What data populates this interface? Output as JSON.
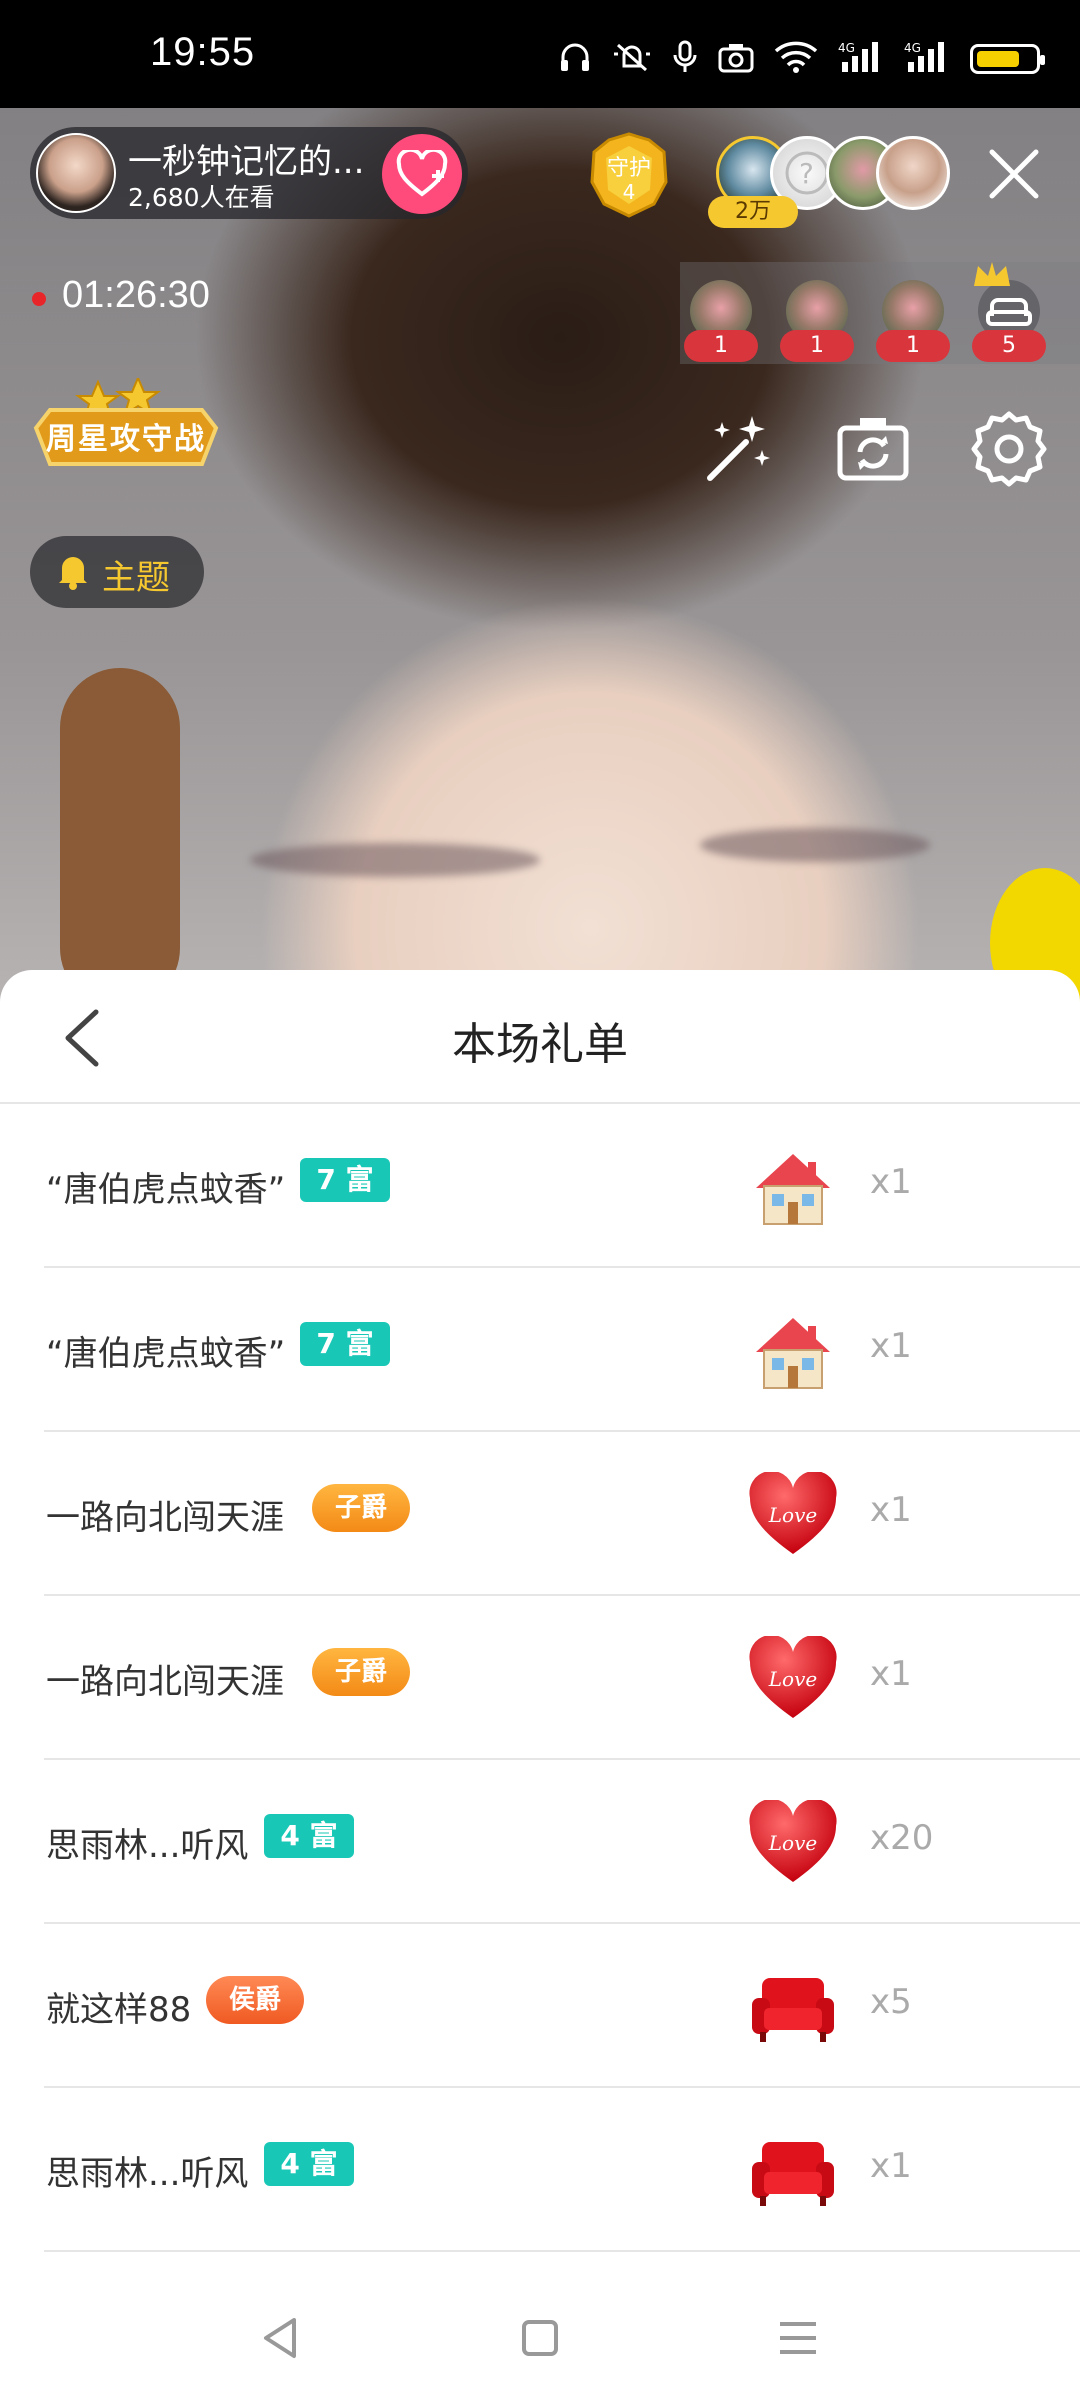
{
  "status_bar": {
    "time": "19:55"
  },
  "live": {
    "anchor": {
      "name": "一秒钟记忆的...",
      "viewers": "2,680人在看"
    },
    "guard": {
      "label": "守护",
      "count": "4"
    },
    "top_badge": "2万",
    "timer": "01:26:30",
    "ranks": [
      "1",
      "1",
      "1",
      "5"
    ],
    "event_label": "周星攻守战",
    "theme_label": "主题"
  },
  "sheet": {
    "title": "本场礼单",
    "rows": [
      {
        "name": "“唐伯虎点蚊香”",
        "badge": "7 富",
        "badge_type": "level",
        "gift": "house",
        "count": "x1"
      },
      {
        "name": "“唐伯虎点蚊香”",
        "badge": "7 富",
        "badge_type": "level",
        "gift": "house",
        "count": "x1"
      },
      {
        "name": "一路向北闯天涯",
        "badge": "子爵",
        "badge_type": "zi",
        "gift": "love-heart",
        "count": "x1"
      },
      {
        "name": "一路向北闯天涯",
        "badge": "子爵",
        "badge_type": "zi",
        "gift": "love-heart",
        "count": "x1"
      },
      {
        "name": "思雨林...听风",
        "badge": "4 富",
        "badge_type": "level",
        "gift": "love-heart",
        "count": "x20"
      },
      {
        "name": "就这样88",
        "badge": "侯爵",
        "badge_type": "hou",
        "gift": "red-sofa",
        "count": "x5"
      },
      {
        "name": "思雨林...听风",
        "badge": "4 富",
        "badge_type": "level",
        "gift": "red-sofa",
        "count": "x1"
      }
    ]
  },
  "colors": {
    "level_badge": "#19c7b6",
    "follow": "#ff4a7c",
    "theme": "#f5c830"
  }
}
